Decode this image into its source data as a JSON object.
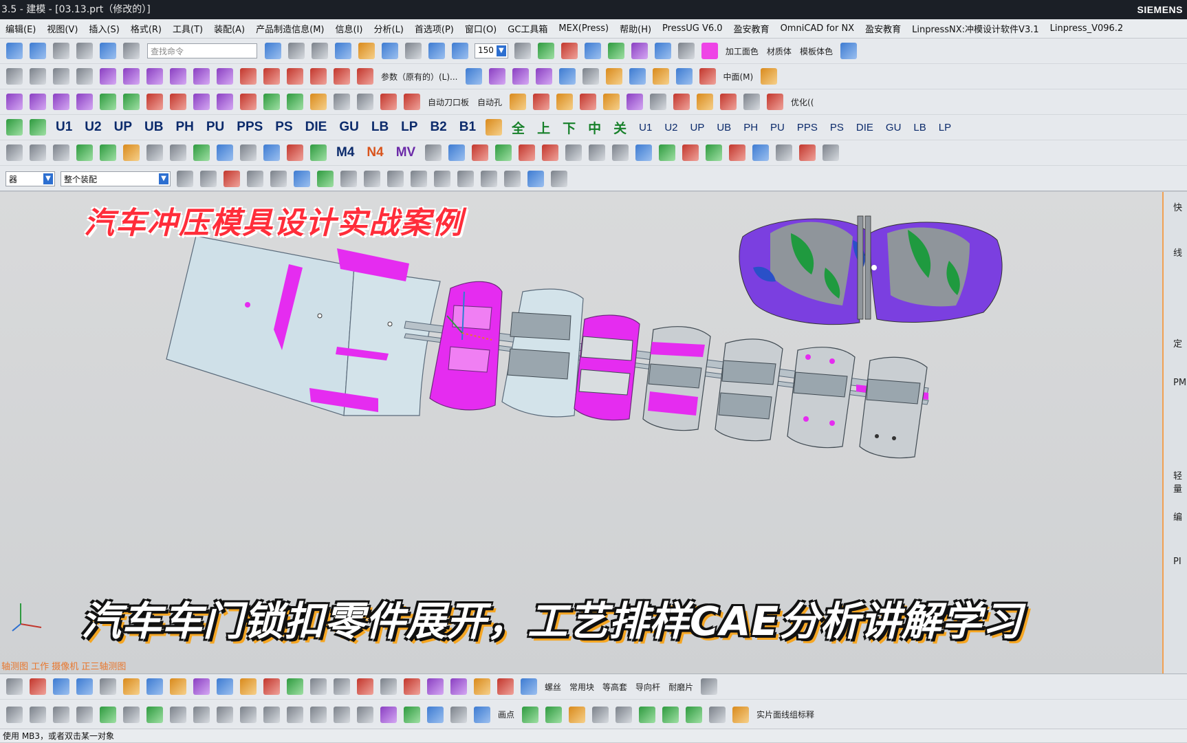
{
  "window": {
    "title": "3.5 - 建模 - [03.13.prt（修改的）]",
    "brand": "SIEMENS"
  },
  "menu": [
    "编辑(E)",
    "视图(V)",
    "插入(S)",
    "格式(R)",
    "工具(T)",
    "装配(A)",
    "产品制造信息(M)",
    "信息(I)",
    "分析(L)",
    "首选项(P)",
    "窗口(O)",
    "GC工具箱",
    "MEX(Press)",
    "帮助(H)",
    "PressUG V6.0",
    "盈安教育",
    "OmniCAD for NX",
    "盈安教育",
    "LinpressNX:冲模设计软件V3.1",
    "Linpress_V096.2"
  ],
  "toolbar": {
    "search_placeholder": "查找命令",
    "zoom_value": "150",
    "labels_row1": [
      "加工面色",
      "材质体",
      "模板体色"
    ],
    "labels_row2": [
      "参数（原有的）(L)...",
      "中面(M)"
    ],
    "labels_row3": [
      "自动刀口板",
      "自动孔",
      "优化(("
    ],
    "mold_codes_left": [
      "U1",
      "U2",
      "UP",
      "UB",
      "PH",
      "PU",
      "PPS",
      "PS",
      "DIE",
      "GU",
      "LB",
      "LP",
      "B2",
      "B1"
    ],
    "mold_codes_cn": [
      "全",
      "上",
      "下",
      "中",
      "关"
    ],
    "mold_codes_right": [
      "U1",
      "U2",
      "UP",
      "UB",
      "PH",
      "PU",
      "PPS",
      "PS",
      "DIE",
      "GU",
      "LB",
      "LP"
    ],
    "labels_row5": [
      "M4",
      "N4",
      "MV"
    ],
    "filter_select": "整个装配",
    "left_select": "器"
  },
  "viewport": {
    "headline": "汽车冲压模具设计实战案例",
    "subtitle": "汽车车门锁扣零件展开，工艺排样CAE分析讲解学习",
    "view_status": "轴测图 工作 摄像机 正三轴测图"
  },
  "resource_bar": [
    "快",
    "线",
    "定",
    "PM",
    "轻量",
    "编",
    "PI"
  ],
  "bottom_toolbar": {
    "labels": [
      "螺丝",
      "常用块",
      "等高套",
      "导向杆",
      "耐磨片",
      "画点",
      "实片面线组标释"
    ]
  },
  "status": "使用 MB3，或者双击某一对象",
  "colors": {
    "title_bg": "#1b1f26",
    "viewport_bg": "#d3d4d6",
    "part_fill": "#cfe0e8",
    "highlight_magenta": "#e52cf0",
    "headline_red": "#ff2d3a",
    "subtitle_shadow": "#f5a623"
  }
}
